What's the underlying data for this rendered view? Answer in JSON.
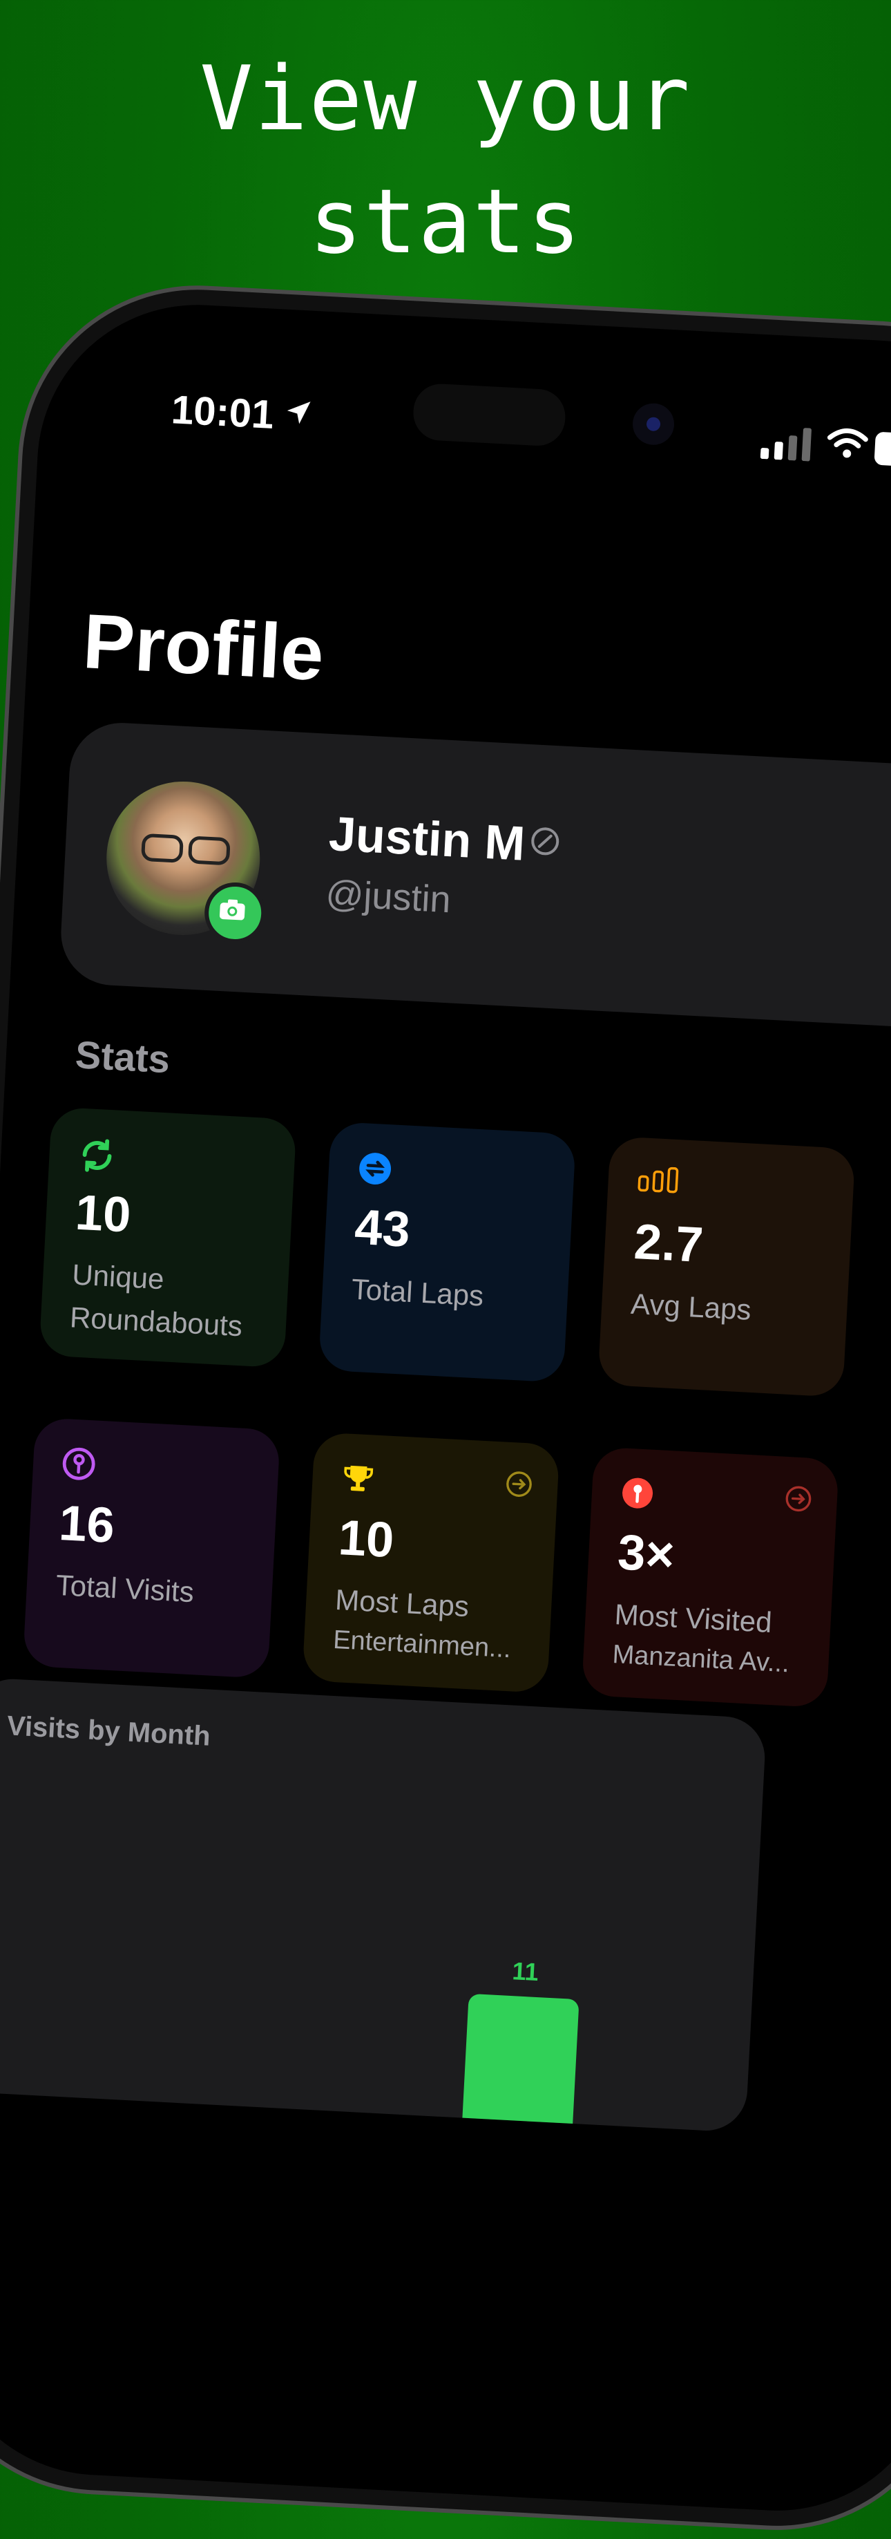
{
  "headline": {
    "line1": "View your",
    "line2": "stats"
  },
  "status_bar": {
    "time": "10:01"
  },
  "page": {
    "title": "Profile"
  },
  "profile": {
    "name": "Justin M",
    "handle": "@justin"
  },
  "stats": {
    "section_title": "Stats",
    "tiles": [
      {
        "value": "10",
        "label": "Unique Roundabouts",
        "icon": "refresh-icon",
        "accent": "#30d158"
      },
      {
        "value": "43",
        "label": "Total Laps",
        "icon": "laps-icon",
        "accent": "#0a84ff"
      },
      {
        "value": "2.7",
        "label": "Avg Laps",
        "icon": "chart-bars-icon",
        "accent": "#ff9f0a"
      },
      {
        "value": "16",
        "label": "Total Visits",
        "icon": "pin-icon",
        "accent": "#bf5af2"
      },
      {
        "value": "10",
        "label": "Most Laps",
        "sub": "Entertainmen...",
        "icon": "trophy-icon",
        "accent": "#ffd60a"
      },
      {
        "value": "3×",
        "label": "Most Visited",
        "sub": "Manzanita Av...",
        "icon": "pin-filled-icon",
        "accent": "#ff453a"
      }
    ]
  },
  "visits_chart": {
    "title": "Visits by Month",
    "chart_data": {
      "type": "bar",
      "values": [
        11
      ],
      "data_labels": [
        "11"
      ],
      "bar_color": "#30d158"
    }
  }
}
